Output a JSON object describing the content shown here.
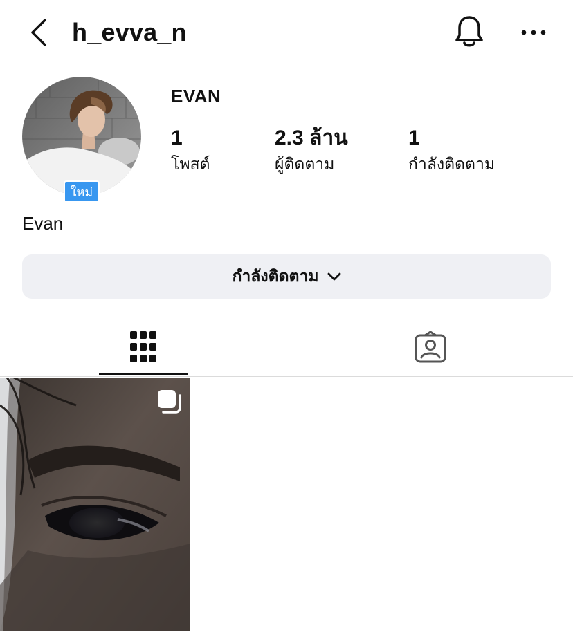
{
  "header": {
    "username": "h_evva_n",
    "back_icon": "chevron-left-icon",
    "bell_icon": "bell-icon",
    "more_icon": "more-horizontal-icon"
  },
  "profile": {
    "display_name": "EVAN",
    "new_badge": "ใหม่",
    "bio_name": "Evan",
    "stats": {
      "posts": {
        "value": "1",
        "label": "โพสต์"
      },
      "followers": {
        "value": "2.3 ล้าน",
        "label": "ผู้ติดตาม"
      },
      "following": {
        "value": "1",
        "label": "กำลังติดตาม"
      }
    }
  },
  "actions": {
    "following_label": "กำลังติดตาม",
    "following_icon": "chevron-down-icon"
  },
  "tabs": [
    {
      "name": "posts-grid",
      "icon": "grid-icon",
      "active": true
    },
    {
      "name": "tagged",
      "icon": "person-tag-icon",
      "active": false
    }
  ],
  "posts": [
    {
      "type": "carousel",
      "indicator_icon": "multiple-posts-icon"
    }
  ],
  "colors": {
    "accent": "#3897f0",
    "button_bg": "#eff0f4",
    "text": "#111111"
  }
}
